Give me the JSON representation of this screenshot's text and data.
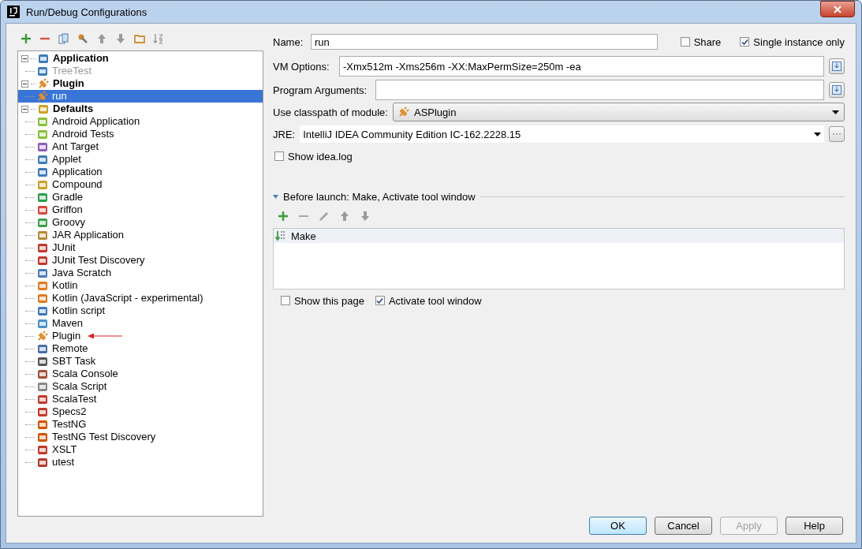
{
  "window": {
    "title": "Run/Debug Configurations"
  },
  "tree": [
    {
      "label": "Application",
      "expanded": true,
      "selected": false,
      "children": [
        {
          "label": "TreeTest",
          "selected": false,
          "temporary": true
        }
      ]
    },
    {
      "label": "Plugin",
      "expanded": true,
      "selected": false,
      "children": [
        {
          "label": "run",
          "selected": true,
          "temporary": false
        }
      ]
    },
    {
      "label": "Defaults",
      "expanded": true,
      "selected": false,
      "children": [
        {
          "label": "Android Application",
          "selected": false,
          "pointed": false
        },
        {
          "label": "Android Tests",
          "selected": false,
          "pointed": false
        },
        {
          "label": "Ant Target",
          "selected": false,
          "pointed": false
        },
        {
          "label": "Applet",
          "selected": false,
          "pointed": false
        },
        {
          "label": "Application",
          "selected": false,
          "pointed": false
        },
        {
          "label": "Compound",
          "selected": false,
          "pointed": false
        },
        {
          "label": "Gradle",
          "selected": false,
          "pointed": false
        },
        {
          "label": "Griffon",
          "selected": false,
          "pointed": false
        },
        {
          "label": "Groovy",
          "selected": false,
          "pointed": false
        },
        {
          "label": "JAR Application",
          "selected": false,
          "pointed": false
        },
        {
          "label": "JUnit",
          "selected": false,
          "pointed": false
        },
        {
          "label": "JUnit Test Discovery",
          "selected": false,
          "pointed": false
        },
        {
          "label": "Java Scratch",
          "selected": false,
          "pointed": false
        },
        {
          "label": "Kotlin",
          "selected": false,
          "pointed": false
        },
        {
          "label": "Kotlin (JavaScript - experimental)",
          "selected": false,
          "pointed": false
        },
        {
          "label": "Kotlin script",
          "selected": false,
          "pointed": false
        },
        {
          "label": "Maven",
          "selected": false,
          "pointed": false
        },
        {
          "label": "Plugin",
          "selected": false,
          "pointed": true
        },
        {
          "label": "Remote",
          "selected": false,
          "pointed": false
        },
        {
          "label": "SBT Task",
          "selected": false,
          "pointed": false
        },
        {
          "label": "Scala Console",
          "selected": false,
          "pointed": false
        },
        {
          "label": "Scala Script",
          "selected": false,
          "pointed": false
        },
        {
          "label": "ScalaTest",
          "selected": false,
          "pointed": false
        },
        {
          "label": "Specs2",
          "selected": false,
          "pointed": false
        },
        {
          "label": "TestNG",
          "selected": false,
          "pointed": false
        },
        {
          "label": "TestNG Test Discovery",
          "selected": false,
          "pointed": false
        },
        {
          "label": "XSLT",
          "selected": false,
          "pointed": false
        },
        {
          "label": "utest",
          "selected": false,
          "pointed": false
        }
      ]
    }
  ],
  "form": {
    "name": {
      "label": "Name:",
      "value": "run"
    },
    "share": {
      "label": "Share",
      "checked": false
    },
    "single_instance": {
      "label": "Single instance only",
      "checked": true
    },
    "vm_options": {
      "label": "VM Options:",
      "value": "-Xmx512m -Xms256m -XX:MaxPermSize=250m -ea"
    },
    "program_arguments": {
      "label": "Program Arguments:"
    },
    "module": {
      "label": "Use classpath of module:",
      "value": "ASPlugin"
    },
    "jre": {
      "label": "JRE:",
      "value": "IntelliJ IDEA Community Edition IC-162.2228.15"
    },
    "show_log": {
      "label": "Show idea.log",
      "checked": false
    }
  },
  "before_launch": {
    "title": "Before launch: Make, Activate tool window",
    "expanded": true,
    "tasks": [
      {
        "label": "Make",
        "selected": true
      }
    ],
    "show_page": {
      "label": "Show this page",
      "checked": false
    },
    "activate": {
      "label": "Activate tool window",
      "checked": true
    }
  },
  "buttons": [
    {
      "label": "OK",
      "kind": "default",
      "disabled": false
    },
    {
      "label": "Cancel",
      "kind": "normal",
      "disabled": false
    },
    {
      "label": "Apply",
      "kind": "normal",
      "disabled": true
    },
    {
      "label": "Help",
      "kind": "normal",
      "disabled": false
    }
  ]
}
